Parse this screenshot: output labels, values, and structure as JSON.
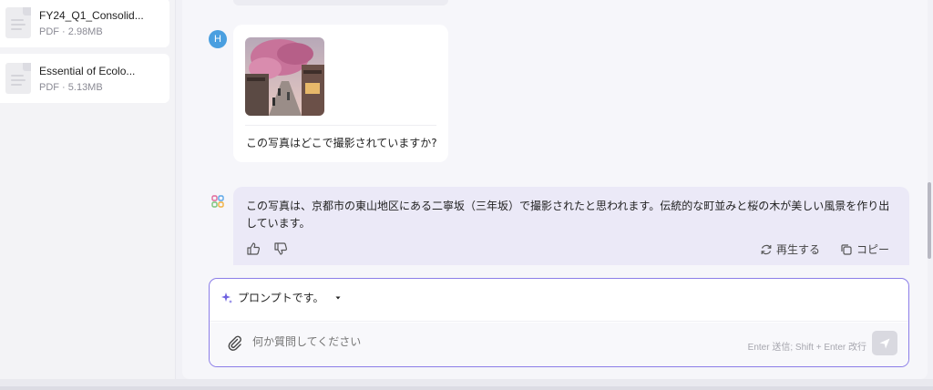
{
  "files": [
    {
      "name": "FY24_Q1_Consolid...",
      "meta": "PDF · 2.98MB"
    },
    {
      "name": "Essential of Ecolo...",
      "meta": "PDF · 5.13MB"
    }
  ],
  "user_message": {
    "avatar_letter": "H",
    "text": "この写真はどこで撮影されていますか?"
  },
  "ai_message": {
    "text": "この写真は、京都市の東山地区にある二寧坂（三年坂）で撮影されたと思われます。伝統的な町並みと桜の木が美しい風景を作り出しています。",
    "regenerate_label": "再生する",
    "copy_label": "コピー"
  },
  "input": {
    "prompt_label": "プロンプトです。",
    "placeholder": "何か質問してください",
    "hint": "Enter 送信; Shift + Enter 改行"
  },
  "colors": {
    "accent": "#8c7ee8",
    "avatar": "#4a9fe0",
    "ai_bubble": "#ebe9f7"
  },
  "icons": [
    "file-icon",
    "thumbs-up-icon",
    "thumbs-down-icon",
    "regenerate-icon",
    "copy-icon",
    "sparkle-icon",
    "chevron-down-icon",
    "paperclip-icon",
    "send-icon"
  ]
}
